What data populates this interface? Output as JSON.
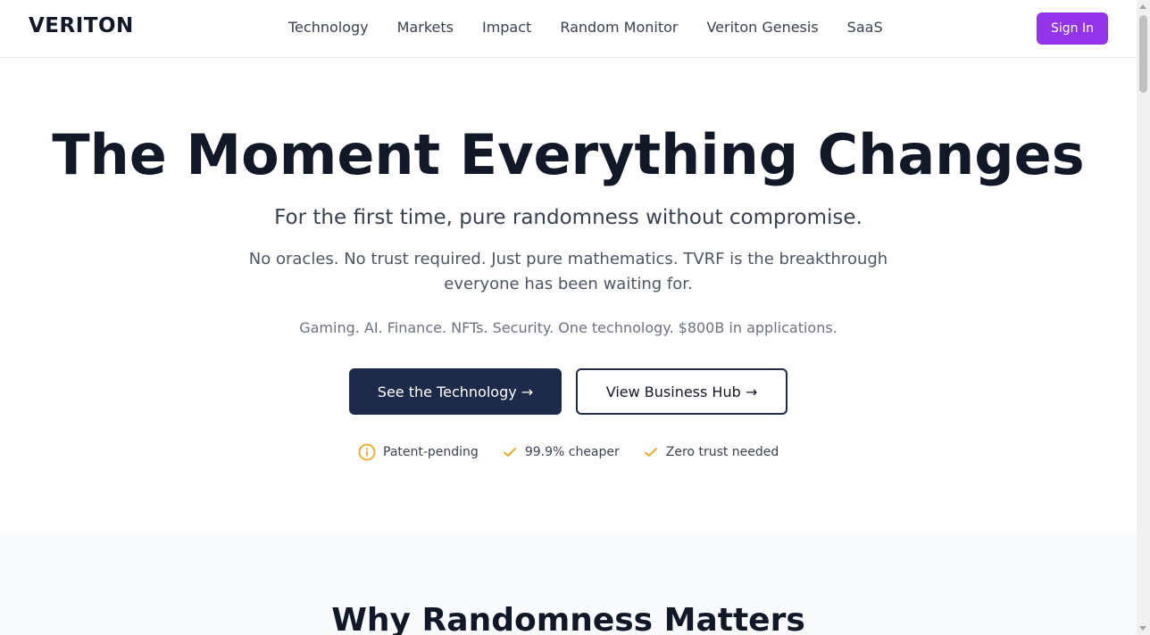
{
  "header": {
    "logo": "VERITON",
    "nav": [
      "Technology",
      "Markets",
      "Impact",
      "Random Monitor",
      "Veriton Genesis",
      "SaaS"
    ],
    "signin_label": "Sign In"
  },
  "hero": {
    "title": "The Moment Everything Changes",
    "subtitle": "For the first time, pure randomness without compromise.",
    "description": "No oracles. No trust required. Just pure mathematics. TVRF is the breakthrough everyone has been waiting for.",
    "applications": "Gaming. AI. Finance. NFTs. Security. One technology. $800B in applications.",
    "primary_cta": "See the Technology →",
    "secondary_cta": "View Business Hub →",
    "badges": [
      {
        "icon": "info-circle-icon",
        "label": "Patent-pending"
      },
      {
        "icon": "check-icon",
        "label": "99.9% cheaper"
      },
      {
        "icon": "check-icon",
        "label": "Zero trust needed"
      }
    ]
  },
  "section2": {
    "title": "Why Randomness Matters"
  },
  "colors": {
    "accent": "#9333ea",
    "navy": "#1e2a4a",
    "badge_icon": "#f59e0b"
  }
}
